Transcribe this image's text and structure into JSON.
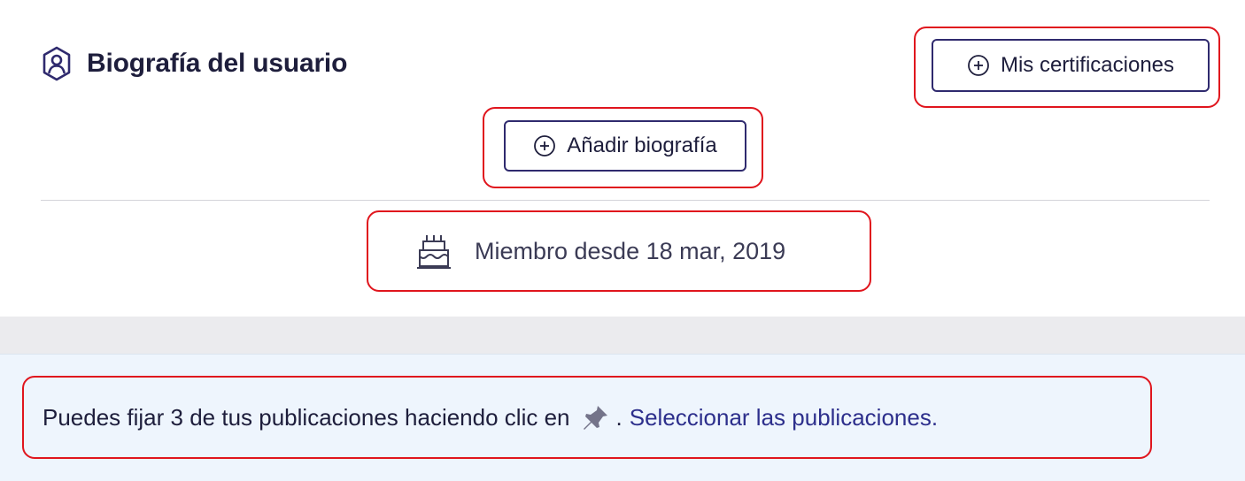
{
  "header": {
    "title": "Biografía del usuario",
    "icon": "user-shield-icon"
  },
  "buttons": {
    "certifications_label": "Mis certificaciones",
    "add_bio_label": "Añadir biografía",
    "icon": "plus-circle-icon"
  },
  "member": {
    "text": "Miembro desde 18 mar, 2019",
    "icon": "cake-icon"
  },
  "pin_info": {
    "text": "Puedes fijar 3 de tus publicaciones haciendo clic en",
    "icon": "pin-icon",
    "after_icon": ".",
    "link_text": "Seleccionar las publicaciones."
  },
  "colors": {
    "primary": "#2f2a6e",
    "link": "#2d2f8c",
    "highlight": "#e0151d",
    "info_background": "#eef5fd",
    "band_background": "#ebebee"
  }
}
